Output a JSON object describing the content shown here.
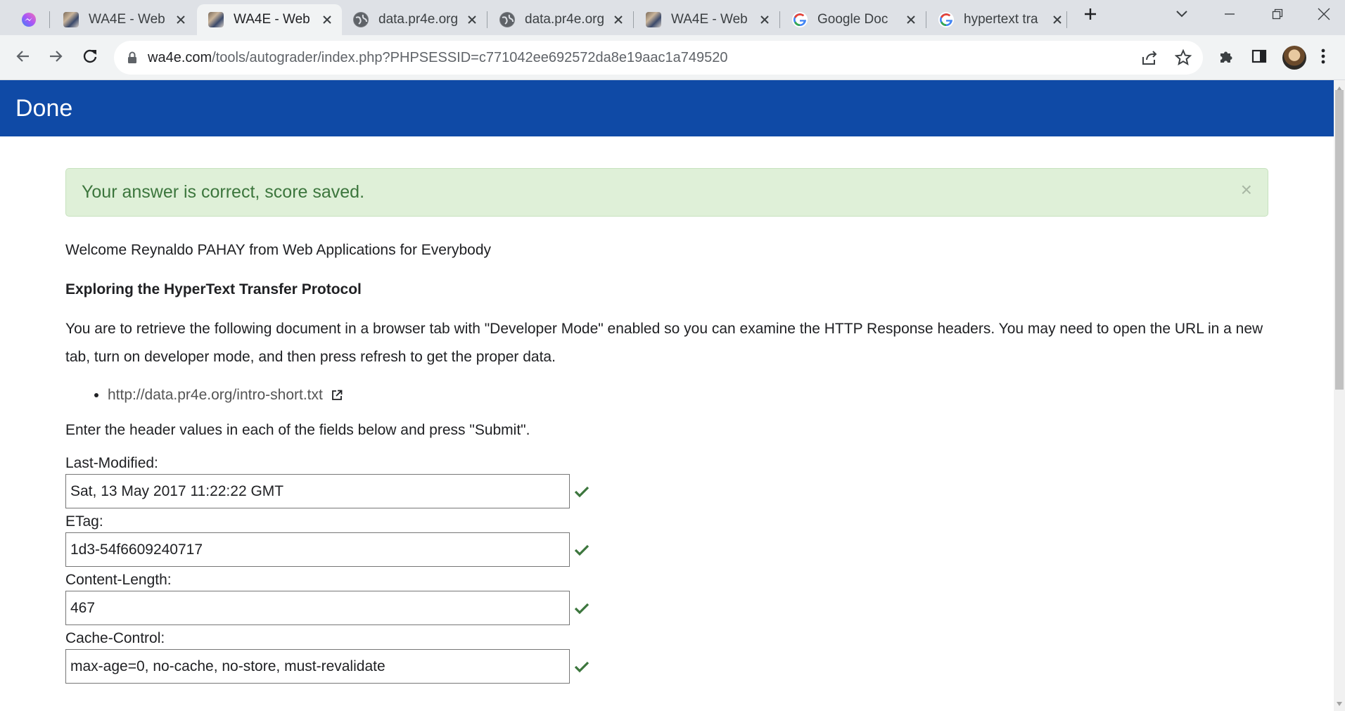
{
  "tabs": [
    {
      "title": "",
      "favicon": "messenger-icon"
    },
    {
      "title": "WA4E - Web",
      "favicon": "wa4e-icon"
    },
    {
      "title": "WA4E - Web",
      "favicon": "wa4e-icon",
      "active": true
    },
    {
      "title": "data.pr4e.org",
      "favicon": "globe-icon"
    },
    {
      "title": "data.pr4e.org",
      "favicon": "globe-icon"
    },
    {
      "title": "WA4E - Web",
      "favicon": "wa4e-icon"
    },
    {
      "title": "Google Doc",
      "favicon": "google-icon"
    },
    {
      "title": "hypertext tra",
      "favicon": "google-icon"
    }
  ],
  "address_bar": {
    "host": "wa4e.com",
    "path": "/tools/autograder/index.php?PHPSESSID=c771042ee692572da8e19aac1a749520"
  },
  "page": {
    "header_title": "Done",
    "alert_text": "Your answer is correct, score saved.",
    "alert_close": "×",
    "welcome": "Welcome Reynaldo PAHAY from Web Applications for Everybody",
    "heading": "Exploring the HyperText Transfer Protocol",
    "description": "You are to retrieve the following document in a browser tab with \"Developer Mode\" enabled so you can examine the HTTP Response headers. You may need to open the URL in a new tab, turn on developer mode, and then press refresh to get the proper data.",
    "doc_link": "http://data.pr4e.org/intro-short.txt",
    "instructions": "Enter the header values in each of the fields below and press \"Submit\".",
    "fields": [
      {
        "label": "Last-Modified:",
        "value": "Sat, 13 May 2017 11:22:22 GMT"
      },
      {
        "label": "ETag:",
        "value": "1d3-54f6609240717"
      },
      {
        "label": "Content-Length:",
        "value": "467"
      },
      {
        "label": "Cache-Control:",
        "value": "max-age=0, no-cache, no-store, must-revalidate"
      }
    ]
  },
  "colors": {
    "header_bg": "#0f4aa6",
    "alert_bg": "#dff0d8",
    "alert_text": "#3c763d",
    "check": "#3c763d"
  }
}
